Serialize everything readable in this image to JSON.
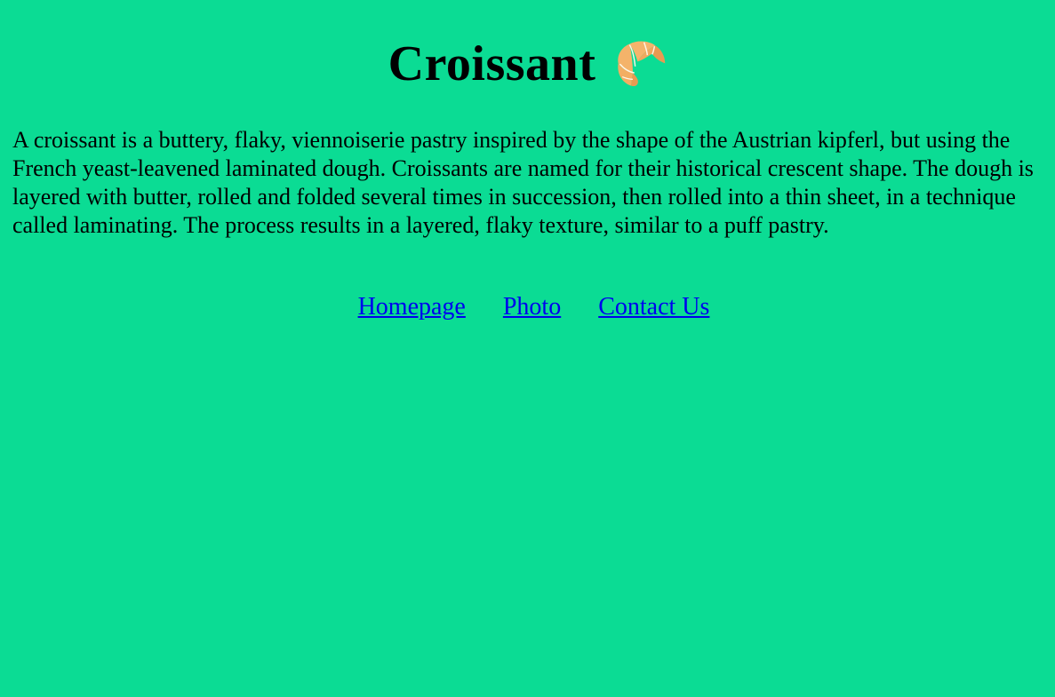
{
  "page": {
    "title": "Croissant",
    "title_icon": "croissant-icon",
    "background_color": "#0bdc94"
  },
  "content": {
    "description": "A croissant is a buttery, flaky, viennoiserie pastry inspired by the shape of the Austrian kipferl, but using the French yeast-leavened laminated dough. Croissants are named for their historical crescent shape. The dough is layered with butter, rolled and folded several times in succession, then rolled into a thin sheet, in a technique called laminating. The process results in a layered, flaky texture, similar to a puff pastry."
  },
  "nav": {
    "links": [
      {
        "label": "Homepage"
      },
      {
        "label": "Photo"
      },
      {
        "label": "Contact Us"
      }
    ],
    "link_color": "#0000ee"
  }
}
